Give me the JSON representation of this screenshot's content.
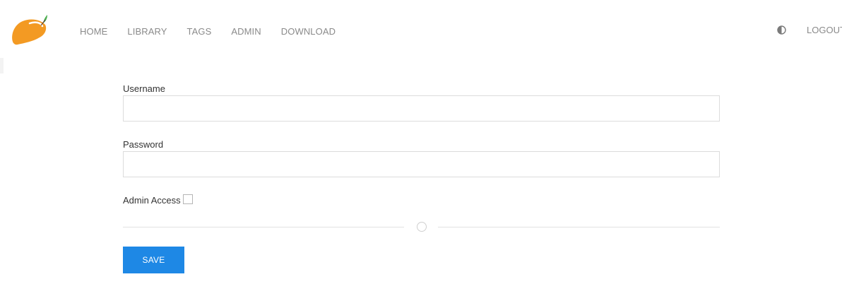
{
  "nav": {
    "logo_icon": "mango-icon",
    "links": [
      "HOME",
      "LIBRARY",
      "TAGS",
      "ADMIN",
      "DOWNLOAD"
    ],
    "theme_icon": "half-circle-contrast-icon",
    "logout_label": "LOGOUT"
  },
  "form": {
    "username_label": "Username",
    "username_value": "",
    "password_label": "Password",
    "password_value": "",
    "admin_label": "Admin Access",
    "admin_checked": false,
    "divider_icon": "circle-icon",
    "save_label": "SAVE"
  },
  "colors": {
    "accent": "#1e88e5",
    "nav_text": "#8a8a8a",
    "logo_orange": "#f39a23",
    "logo_leaf": "#4caf50"
  }
}
